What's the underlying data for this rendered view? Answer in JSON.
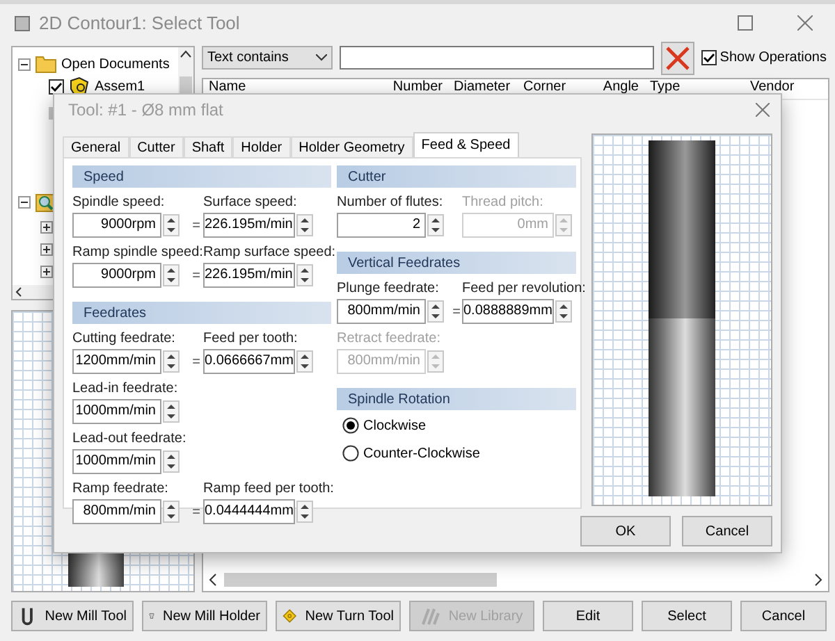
{
  "window": {
    "title": "2D Contour1: Select Tool"
  },
  "tree": [
    {
      "label": "Open Documents",
      "expanded": true,
      "children": [
        {
          "label": "Assem1",
          "checked": true
        }
      ]
    },
    {
      "expanded": true,
      "children": [
        {
          "expanded": false
        },
        {
          "expanded": false
        },
        {
          "expanded": false
        }
      ]
    }
  ],
  "filter": {
    "mode": "Text contains",
    "show_operations": {
      "label": "Show Operations",
      "checked": true
    }
  },
  "table": {
    "columns": [
      "Name",
      "Number",
      "Diameter",
      "Corner",
      "Angle",
      "Type",
      "Vendor"
    ]
  },
  "buttons": [
    {
      "label": "New Mill Tool",
      "kind": "mill",
      "disabled": false
    },
    {
      "label": "New Mill Holder",
      "kind": "holder",
      "disabled": false
    },
    {
      "label": "New Turn Tool",
      "kind": "turn",
      "disabled": false
    },
    {
      "label": "New Library",
      "kind": "library",
      "disabled": true
    },
    {
      "label": "Edit",
      "disabled": false
    },
    {
      "label": "Select",
      "disabled": false
    },
    {
      "label": "Cancel",
      "disabled": false
    }
  ],
  "dialog": {
    "title": "Tool: #1 - Ø8 mm flat",
    "tabs": [
      {
        "label": "General",
        "selected": false
      },
      {
        "label": "Cutter",
        "selected": false
      },
      {
        "label": "Shaft",
        "selected": false
      },
      {
        "label": "Holder",
        "selected": false
      },
      {
        "label": "Holder Geometry",
        "selected": false
      },
      {
        "label": "Feed & Speed",
        "selected": true
      }
    ],
    "columns": [
      [
        {
          "title": "Speed",
          "rows": [
            {
              "link": "=",
              "fields": [
                {
                  "label": "Spindle speed:",
                  "value": "9000rpm",
                  "disabled": false
                },
                {
                  "label": "Surface speed:",
                  "value": "226.195m/min",
                  "disabled": false
                }
              ]
            },
            {
              "link": "=",
              "fields": [
                {
                  "label": "Ramp spindle speed:",
                  "value": "9000rpm",
                  "disabled": false
                },
                {
                  "label": "Ramp surface speed:",
                  "value": "226.195m/min",
                  "disabled": false
                }
              ]
            }
          ]
        },
        {
          "title": "Feedrates",
          "rows": [
            {
              "link": "=",
              "fields": [
                {
                  "label": "Cutting feedrate:",
                  "value": "1200mm/min",
                  "disabled": false
                },
                {
                  "label": "Feed per tooth:",
                  "value": "0.0666667mm",
                  "disabled": false
                }
              ]
            },
            {
              "fields": [
                {
                  "label": "Lead-in feedrate:",
                  "value": "1000mm/min",
                  "disabled": false
                }
              ]
            },
            {
              "fields": [
                {
                  "label": "Lead-out feedrate:",
                  "value": "1000mm/min",
                  "disabled": false
                }
              ]
            },
            {
              "link": "=",
              "fields": [
                {
                  "label": "Ramp feedrate:",
                  "value": "800mm/min",
                  "disabled": false
                },
                {
                  "label": "Ramp feed per tooth:",
                  "value": "0.0444444mm",
                  "disabled": false
                }
              ]
            }
          ]
        }
      ],
      [
        {
          "title": "Cutter",
          "rows": [
            {
              "fields": [
                {
                  "label": "Number of flutes:",
                  "value": "2",
                  "disabled": false
                },
                {
                  "label": "Thread pitch:",
                  "value": "0mm",
                  "disabled": true
                }
              ]
            }
          ]
        },
        {
          "title": "Vertical Feedrates",
          "rows": [
            {
              "link": "=",
              "fields": [
                {
                  "label": "Plunge feedrate:",
                  "value": "800mm/min",
                  "disabled": false
                },
                {
                  "label": "Feed per revolution:",
                  "value": "0.0888889mm",
                  "disabled": false
                }
              ]
            },
            {
              "fields": [
                {
                  "label": "Retract feedrate:",
                  "value": "800mm/min",
                  "disabled": true
                }
              ]
            }
          ]
        },
        {
          "title": "Spindle Rotation",
          "radios": [
            {
              "label": "Clockwise",
              "selected": true
            },
            {
              "label": "Counter-Clockwise",
              "selected": false
            }
          ]
        }
      ]
    ],
    "buttons": [
      "OK",
      "Cancel"
    ]
  }
}
